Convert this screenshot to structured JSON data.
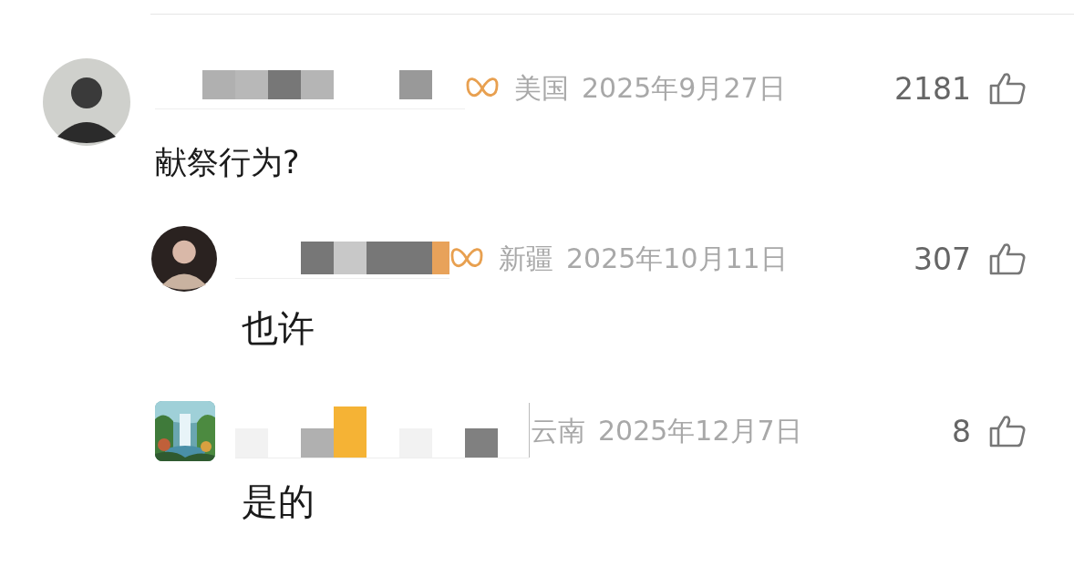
{
  "comments": [
    {
      "avatar": {
        "kind": "person"
      },
      "badge": true,
      "location": "美国",
      "date": "2025年9月27日",
      "likes": "2181",
      "text": "献祭行为?",
      "replies": [
        {
          "avatar": {
            "kind": "person"
          },
          "badge": true,
          "location": "新疆",
          "date": "2025年10月11日",
          "likes": "307",
          "text": "也许"
        },
        {
          "badge": false,
          "location": "云南",
          "date": "2025年12月7日",
          "likes": "8",
          "text": "是的"
        }
      ]
    }
  ]
}
